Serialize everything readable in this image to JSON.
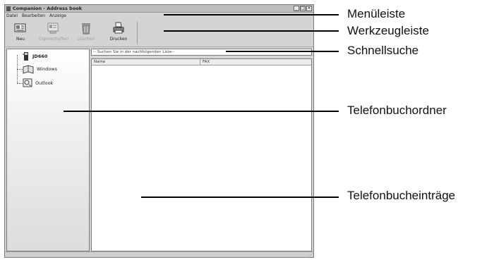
{
  "window": {
    "title": "Companion - Address book",
    "buttons": {
      "minimize": "_",
      "maximize": "□",
      "close": "×"
    }
  },
  "menubar": {
    "items": [
      "Datei",
      "Bearbeiten",
      "Anzeige"
    ]
  },
  "toolbar": {
    "buttons": [
      {
        "label": "Neu",
        "icon": "new-contact-icon",
        "enabled": true
      },
      {
        "label": "Eigenschaften",
        "icon": "properties-icon",
        "enabled": false
      },
      {
        "label": "Löschen",
        "icon": "trash-icon",
        "enabled": false
      },
      {
        "label": "Drucken",
        "icon": "printer-icon",
        "enabled": true
      }
    ]
  },
  "sidebar": {
    "root": {
      "label": "JD660",
      "icon": "phone-device-icon"
    },
    "children": [
      {
        "label": "Windows",
        "icon": "address-book-icon"
      },
      {
        "label": "Outlook",
        "icon": "outlook-icon"
      }
    ]
  },
  "search": {
    "placeholder": "-- Suchen Sie in der nachfolgenden Liste--"
  },
  "list": {
    "columns": [
      "Name",
      "FAX"
    ],
    "rows": []
  },
  "statusbar": {
    "grip": "⋰"
  },
  "callouts": {
    "menubar": "Menüleiste",
    "toolbar": "Werkzeugleiste",
    "search": "Schnellsuche",
    "folders": "Telefonbuchordner",
    "entries": "Telefonbucheinträge"
  }
}
